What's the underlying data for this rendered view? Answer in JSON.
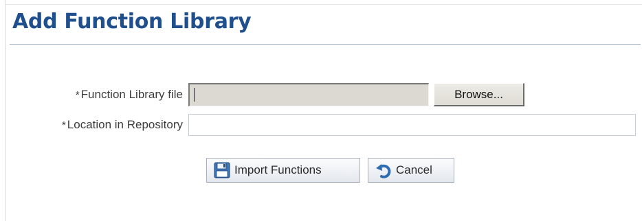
{
  "page": {
    "title": "Add Function Library"
  },
  "form": {
    "required_marker": "*",
    "function_library_file": {
      "label": "Function Library file",
      "value": "",
      "browse_label": "Browse..."
    },
    "location_in_repository": {
      "label": "Location in Repository",
      "value": "",
      "placeholder": ""
    }
  },
  "actions": {
    "import_label": "Import Functions",
    "import_icon": "save-icon",
    "cancel_label": "Cancel",
    "cancel_icon": "undo-icon"
  },
  "colors": {
    "title": "#1f4f8c",
    "accent_icon": "#2f6db3"
  }
}
